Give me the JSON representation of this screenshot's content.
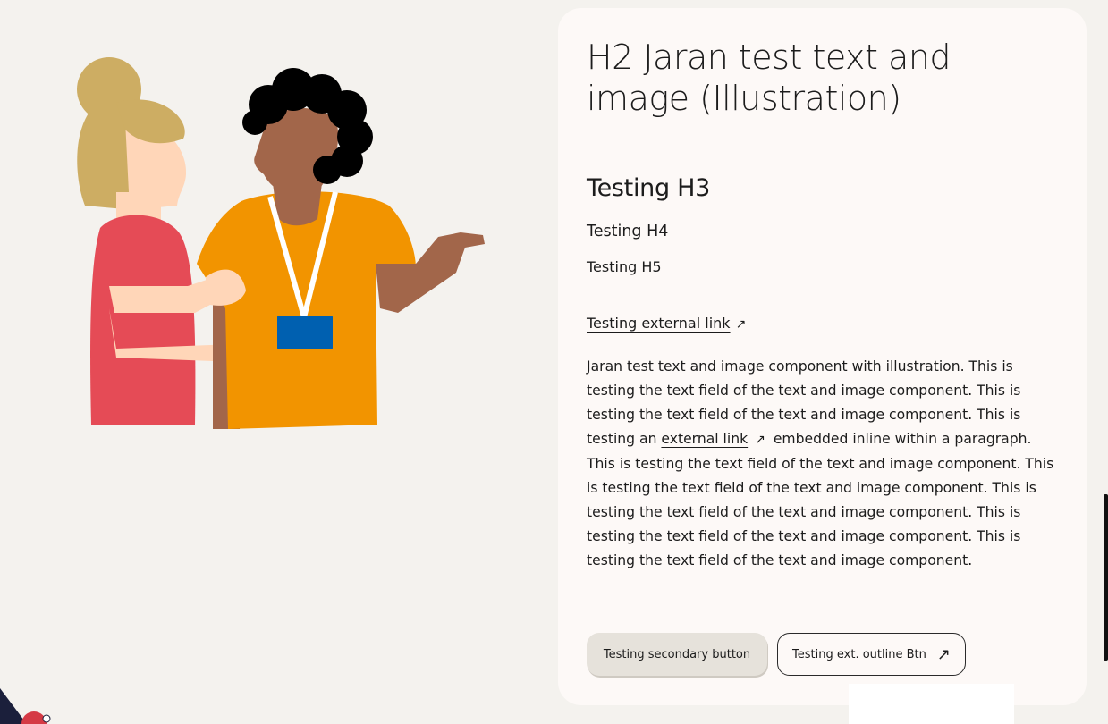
{
  "card": {
    "h2": "H2 Jaran test text and image (Illustration)",
    "h3": "Testing H3",
    "h4": "Testing H4",
    "h5": "Testing H5",
    "external_link": "Testing external link",
    "paragraph": {
      "before_link": "Jaran test text and image component with illustration. This is testing the text field of the text and image component. This is testing the text field of the text and image component. This is testing an ",
      "link_text": "external link",
      "after_link": " embedded inline within a paragraph. This is testing the text field of the text and image component. This is testing the text field of the text and image component. This is testing the text field of the text and image component. This is testing the text field of the text and image component. This is testing the text field of the text and image component."
    },
    "buttons": {
      "secondary": "Testing secondary button",
      "outline": "Testing ext. outline Btn"
    }
  },
  "icons": {
    "external_arrow": "arrow-up-right-icon",
    "arrow_glyph": "↗"
  },
  "colors": {
    "page_bg": "#f4f2ee",
    "card_bg": "#fdf9f7",
    "secondary_btn_bg": "#e6e2db"
  }
}
